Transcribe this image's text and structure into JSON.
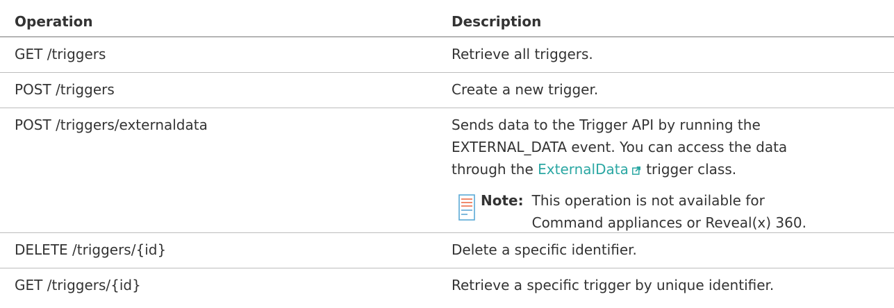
{
  "table": {
    "headers": {
      "operation": "Operation",
      "description": "Description"
    },
    "rows": [
      {
        "operation": "GET /triggers",
        "description": "Retrieve all triggers."
      },
      {
        "operation": "POST /triggers",
        "description": "Create a new trigger."
      },
      {
        "operation": "POST /triggers/externaldata",
        "description_line1": "Sends data to the Trigger API by running the",
        "description_line2": "EXTERNAL_DATA event. You can access the data",
        "description_line3_before": "through the ",
        "link_text": "ExternalData",
        "description_line3_after": " trigger class.",
        "note_label": "Note:",
        "note_line1": "This operation is not available for",
        "note_line2": "Command appliances or Reveal(x) 360."
      },
      {
        "operation": "DELETE /triggers/{id}",
        "description": "Delete a specific identifier."
      },
      {
        "operation": "GET /triggers/{id}",
        "description": "Retrieve a specific trigger by unique identifier."
      }
    ]
  },
  "icons": {
    "external_link": "external-link-icon",
    "note": "note-icon"
  },
  "colors": {
    "link": "#2ba7a3",
    "note_icon_stripes": "#f08a6c",
    "note_icon_outline": "#5aa9d6",
    "text": "#333333",
    "divider": "#bcbcbc"
  }
}
